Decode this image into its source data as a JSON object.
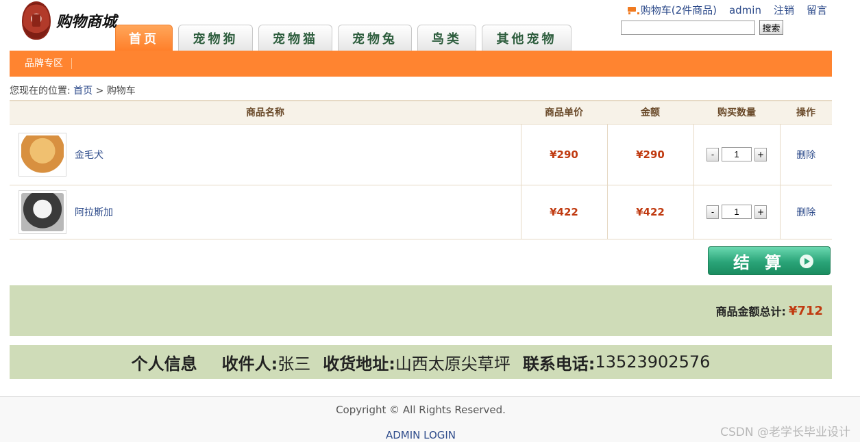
{
  "logo": {
    "text": "购物商城"
  },
  "nav": {
    "tabs": [
      "首页",
      "宠物狗",
      "宠物猫",
      "宠物兔",
      "鸟类",
      "其他宠物"
    ]
  },
  "topbar": {
    "cart": "购物车(2件商品)",
    "user": "admin",
    "logout": "注销",
    "message": "留言"
  },
  "search": {
    "value": "",
    "button": "搜索"
  },
  "subnav": {
    "brand": "品牌专区"
  },
  "breadcrumb": {
    "prefix": "您现在的位置:",
    "home": "首页",
    "sep": ">",
    "current": "购物车"
  },
  "cart": {
    "headers": [
      "商品名称",
      "商品单价",
      "金额",
      "购买数量",
      "操作"
    ],
    "items": [
      {
        "name": "金毛犬",
        "price": "¥290",
        "amount": "¥290",
        "qty": "1",
        "action": "删除"
      },
      {
        "name": "阿拉斯加",
        "price": "¥422",
        "amount": "¥422",
        "qty": "1",
        "action": "删除"
      }
    ],
    "minus": "-",
    "plus": "+",
    "checkout": "结算",
    "total_label": "商品金额总计:",
    "total_value": "¥712"
  },
  "info": {
    "title": "个人信息",
    "receiver_label": "收件人:",
    "receiver": "张三",
    "address_label": "收货地址:",
    "address": "山西太原尖草坪",
    "phone_label": "联系电话:",
    "phone": "13523902576"
  },
  "footer": {
    "copyright": "Copyright © All Rights Reserved.",
    "admin": "ADMIN LOGIN",
    "watermark": "CSDN @老学长毕业设计"
  },
  "colors": {
    "accent": "#ff8430",
    "price": "#c03a10",
    "panel": "#cfdcb8",
    "checkout": "#2aa478"
  }
}
